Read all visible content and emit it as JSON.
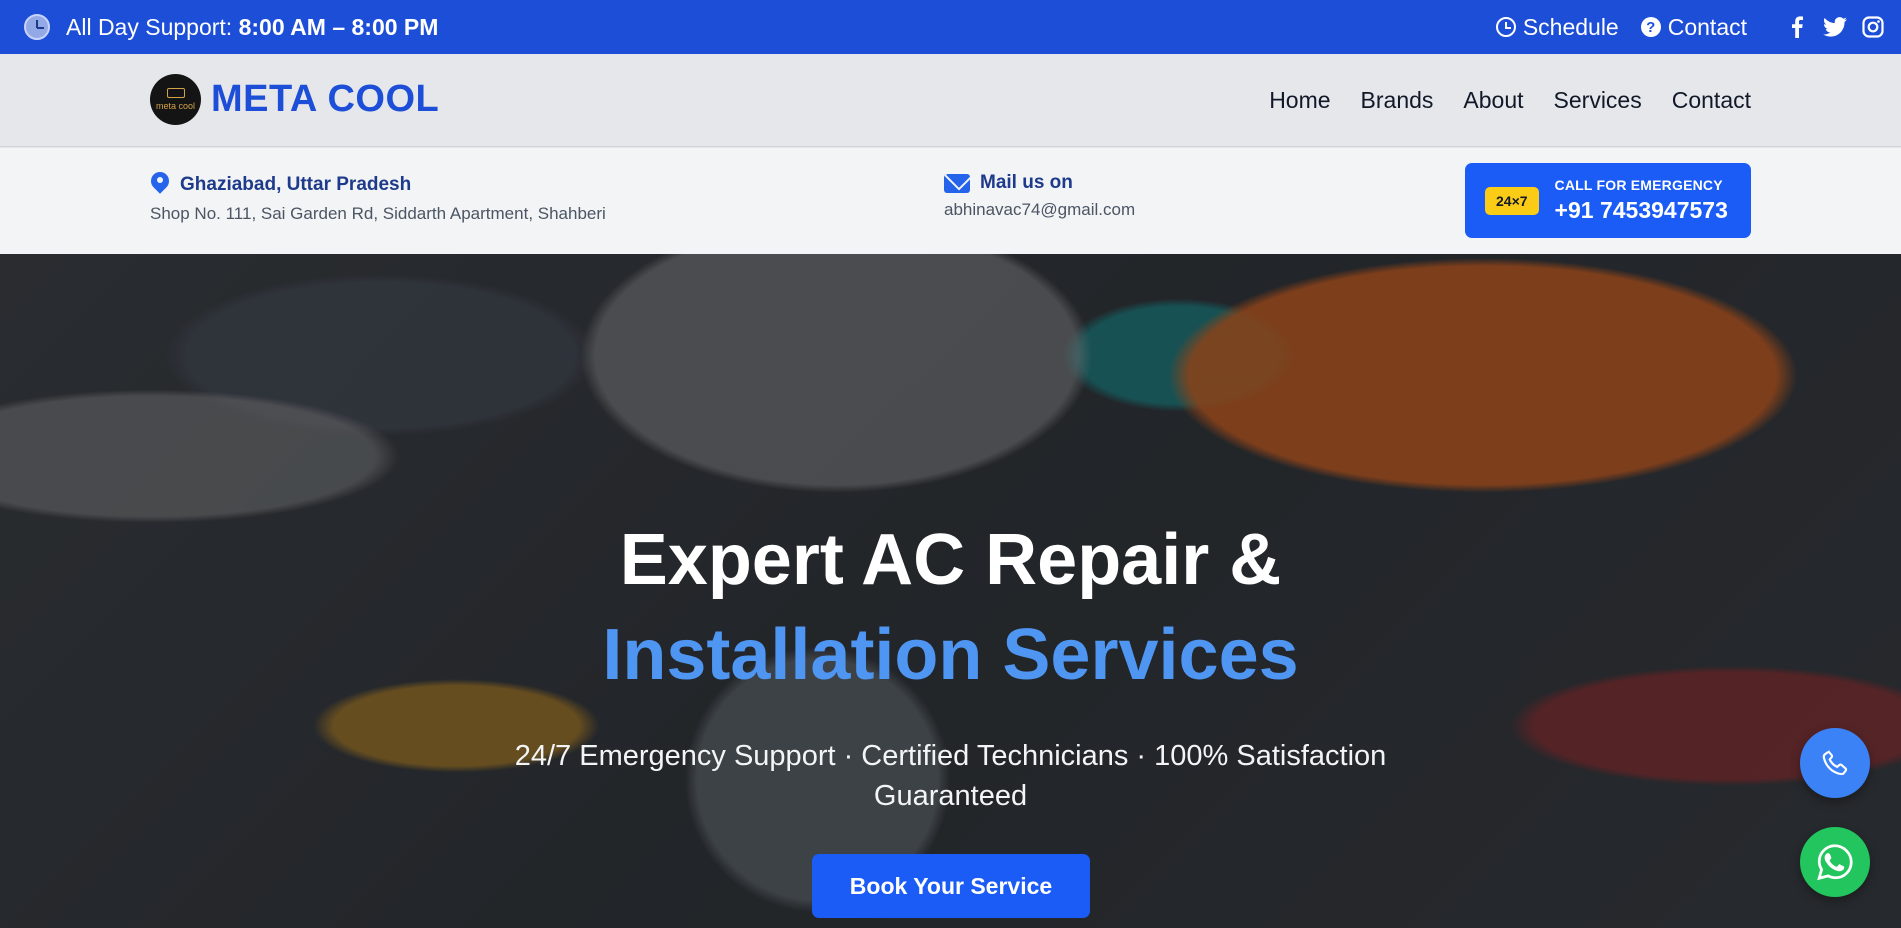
{
  "topbar": {
    "support_label": "All Day Support:",
    "support_hours": "8:00 AM – 8:00 PM",
    "links": [
      {
        "label": "Schedule",
        "icon": "clock-icon"
      },
      {
        "label": "Contact",
        "icon": "question-icon"
      }
    ],
    "social_icons": [
      "facebook-icon",
      "twitter-icon",
      "instagram-icon"
    ],
    "background": "#1d4ed8"
  },
  "header": {
    "logo_text": "meta cool",
    "brand_name": "META COOL",
    "brand_color": "#1d4ed8",
    "nav": [
      "Home",
      "Brands",
      "About",
      "Services",
      "Contact"
    ]
  },
  "info": {
    "location_title": "Ghaziabad, Uttar Pradesh",
    "location_address": "Shop No. 111, Sai Garden Rd, Siddarth Apartment, Shahberi",
    "mail_title": "Mail us on",
    "mail_address": "abhinavac74@gmail.com",
    "emergency_badge": "24×7",
    "emergency_label": "CALL FOR EMERGENCY",
    "emergency_phone": "+91 7453947573"
  },
  "hero": {
    "title_line1": "Expert AC Repair &",
    "title_line2": "Installation Services",
    "title_accent": "#4f96f3",
    "subtitle": "24/7 Emergency Support · Certified Technicians · 100% Satisfaction Guaranteed",
    "cta_label": "Book Your Service"
  },
  "floating": {
    "phone_color": "#3b82f6",
    "whatsapp_color": "#22c55e"
  }
}
